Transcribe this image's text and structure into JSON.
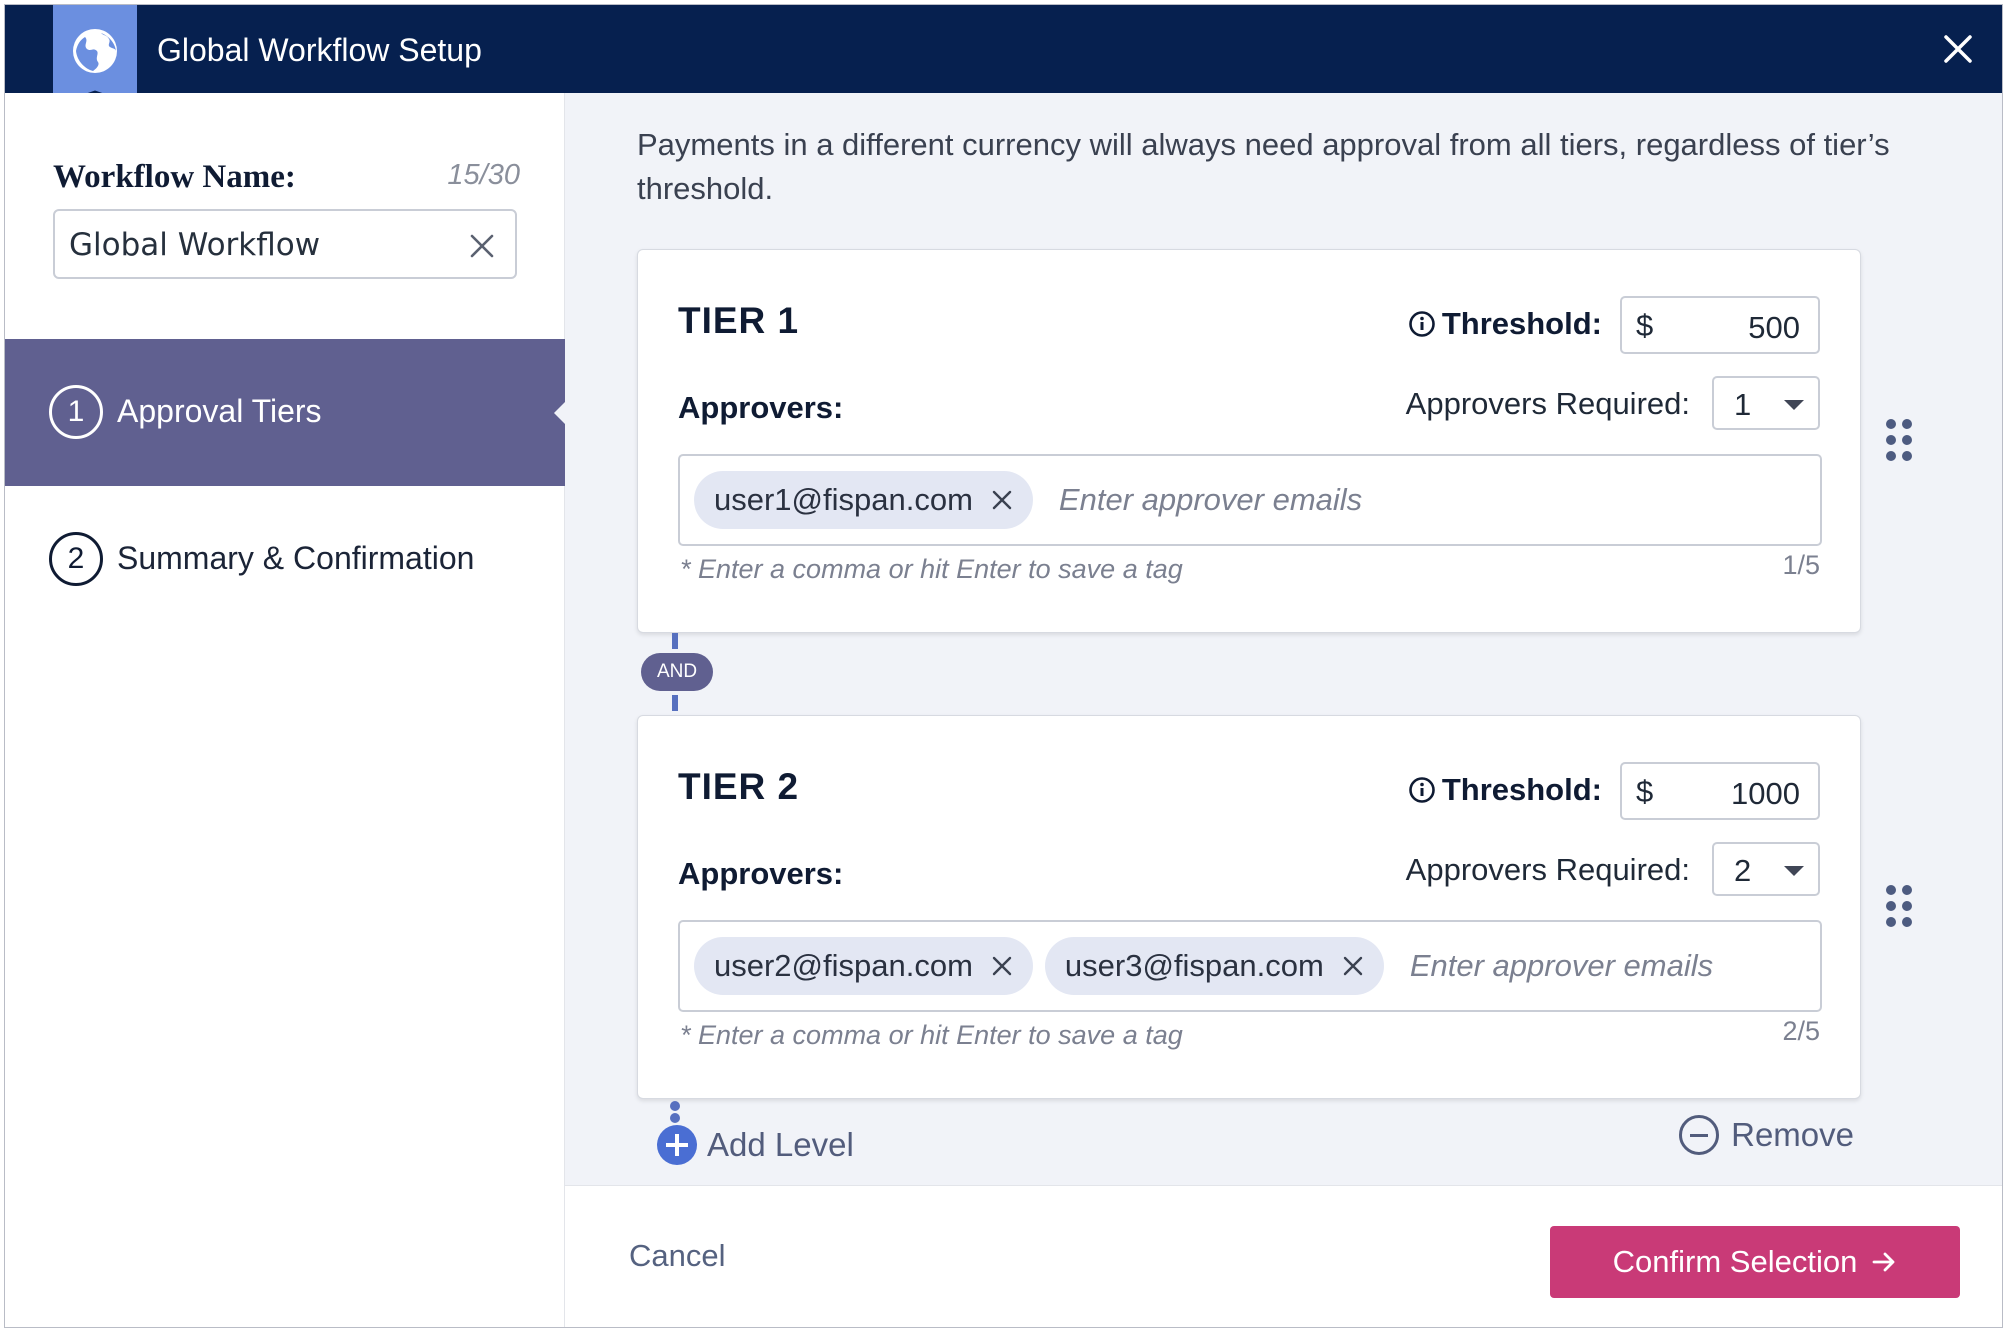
{
  "header": {
    "title": "Global Workflow Setup",
    "icon": "globe-icon",
    "close_icon": "close-icon"
  },
  "sidebar": {
    "workflow_name_label": "Workflow Name:",
    "workflow_name_count": "15/30",
    "workflow_name_value": "Global Workflow",
    "steps": [
      {
        "number": "1",
        "label": "Approval Tiers",
        "active": true
      },
      {
        "number": "2",
        "label": "Summary & Confirmation",
        "active": false
      }
    ]
  },
  "main": {
    "note": "Payments in a different currency will always need approval from all tiers, regardless of tier’s threshold.",
    "tiers": [
      {
        "title": "TIER 1",
        "threshold_label": "Threshold:",
        "currency": "$",
        "threshold_value": "500",
        "approvers_label": "Approvers:",
        "approvers_required_label": "Approvers Required:",
        "approvers_required": "1",
        "tags": [
          "user1@fispan.com"
        ],
        "placeholder": "Enter approver emails",
        "hint": "* Enter a comma or hit Enter to save a tag",
        "count": "1/5"
      },
      {
        "title": "TIER 2",
        "threshold_label": "Threshold:",
        "currency": "$",
        "threshold_value": "1000",
        "approvers_label": "Approvers:",
        "approvers_required_label": "Approvers Required:",
        "approvers_required": "2",
        "tags": [
          "user2@fispan.com",
          "user3@fispan.com"
        ],
        "placeholder": "Enter approver emails",
        "hint": "* Enter a comma or hit Enter to save a tag",
        "count": "2/5"
      }
    ],
    "connector_label": "AND",
    "add_level_label": "Add Level",
    "remove_label": "Remove"
  },
  "footer": {
    "cancel_label": "Cancel",
    "confirm_label": "Confirm Selection"
  },
  "colors": {
    "header_bg": "#06204f",
    "badge": "#6b8fe0",
    "active_step": "#606090",
    "confirm_button": "#c93a77",
    "content_bg": "#f1f3f8"
  }
}
